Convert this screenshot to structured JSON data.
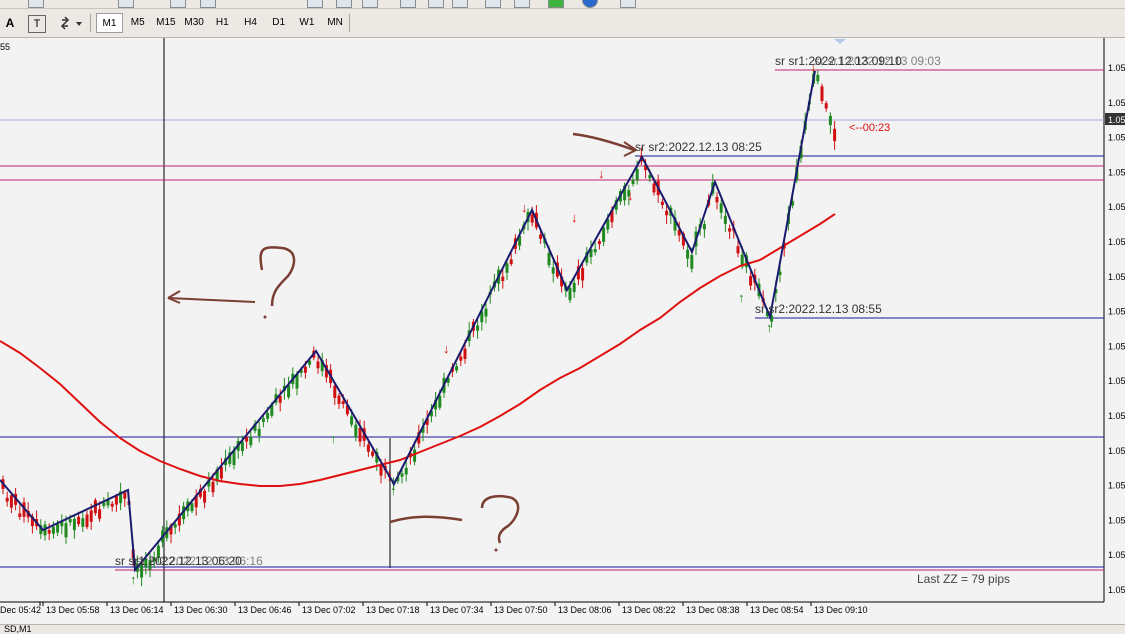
{
  "toolbar": {
    "auto_label": "A",
    "text_tool_label": "T",
    "timeframes": [
      "M1",
      "M5",
      "M15",
      "M30",
      "H1",
      "H4",
      "D1",
      "W1",
      "MN"
    ],
    "active_timeframe": "M1"
  },
  "chart": {
    "corner_label": "55",
    "price_labels": [
      "1.05",
      "1.05",
      "1.05",
      "1.05",
      "1.05",
      "1.05",
      "1.05",
      "1.05",
      "1.05",
      "1.05",
      "1.05",
      "1.05",
      "1.05",
      "1.05",
      "1.05",
      "1.05"
    ],
    "current_price_label": "1.05",
    "x_axis_labels": [
      "Dec 05:42",
      "13 Dec 05:58",
      "13 Dec 06:14",
      "13 Dec 06:30",
      "13 Dec 06:46",
      "13 Dec 07:02",
      "13 Dec 07:18",
      "13 Dec 07:34",
      "13 Dec 07:50",
      "13 Dec 08:06",
      "13 Dec 08:22",
      "13 Dec 08:38",
      "13 Dec 08:54",
      "13 Dec 09:10"
    ],
    "sr_labels": {
      "top": "sr sr1:2022.12.13 09:10",
      "top_overlap": "sr sr1:2022.12.13 09:03",
      "mid": "sr sr2:2022.12.13 08:25",
      "low": "sr sr2:2022.12.13 08:55",
      "bottom": "sr sr1:2022.12.13 06:20",
      "bottom_overlap": "sr sr2:2022.12.13 06:16"
    },
    "countdown": "<--00:23",
    "last_zz": "Last ZZ = 79 pips",
    "annotation_marks": [
      "?",
      "?"
    ]
  },
  "status": {
    "symbol_label": "SD,M1"
  },
  "colors": {
    "zigzag": "#1a1a6e",
    "ma": "#e01010",
    "up_candle": "#1f8a1f",
    "down_candle": "#d01010",
    "hline_blue": "#1a1a9a",
    "hline_magenta": "#c0206a",
    "annotation": "#7a3e32"
  }
}
